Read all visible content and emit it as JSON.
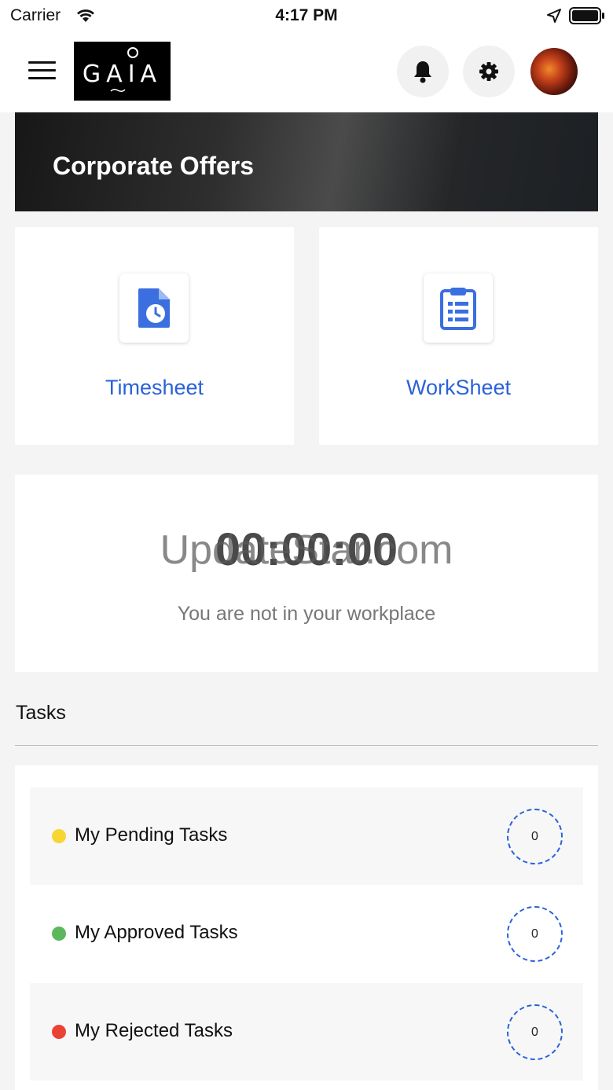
{
  "status_bar": {
    "carrier": "Carrier",
    "time": "4:17 PM"
  },
  "header": {
    "logo_text": "GAIA",
    "icons": [
      "menu-icon",
      "bell-icon",
      "gear-icon",
      "avatar"
    ]
  },
  "banner": {
    "title": "Corporate Offers"
  },
  "tiles": [
    {
      "label": "Timesheet",
      "icon": "timesheet-icon"
    },
    {
      "label": "WorkSheet",
      "icon": "clipboard-list-icon"
    }
  ],
  "timer": {
    "value": "00:00:00",
    "message": "You are not in your workplace",
    "watermark": "UpdateStar.com"
  },
  "tasks": {
    "title": "Tasks",
    "items": [
      {
        "label": "My Pending Tasks",
        "count": "0",
        "dot_color": "#f6d631"
      },
      {
        "label": "My Approved Tasks",
        "count": "0",
        "dot_color": "#5cb85c"
      },
      {
        "label": "My Rejected Tasks",
        "count": "0",
        "dot_color": "#ea4335"
      }
    ]
  },
  "colors": {
    "accent": "#2a62d8",
    "background": "#f4f4f4"
  }
}
